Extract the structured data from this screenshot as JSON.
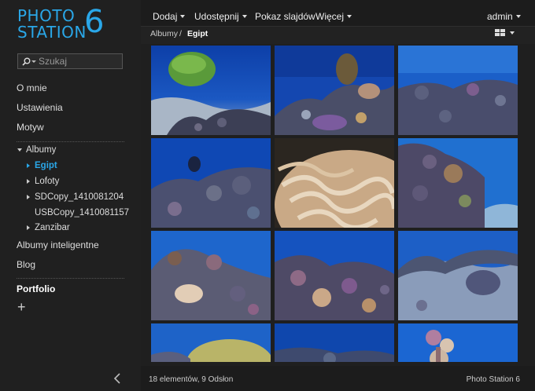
{
  "app": {
    "logo_line1": "PHOTO",
    "logo_line2": "STATION",
    "logo_version": "6",
    "accent_color": "#2aa7e8"
  },
  "search": {
    "placeholder": "Szukaj",
    "icon": "search-icon"
  },
  "sidebar": {
    "items": [
      {
        "label": "O mnie"
      },
      {
        "label": "Ustawienia"
      },
      {
        "label": "Motyw"
      }
    ],
    "albums_label": "Albumy",
    "albums": [
      {
        "label": "Egipt",
        "active": true,
        "expandable": true
      },
      {
        "label": "Lofoty",
        "expandable": true
      },
      {
        "label": "SDCopy_1410081204",
        "expandable": true
      },
      {
        "label": "USBCopy_1410081157",
        "expandable": false
      },
      {
        "label": "Zanzibar",
        "expandable": true
      }
    ],
    "smart_albums_label": "Albumy inteligentne",
    "blog_label": "Blog",
    "portfolio_label": "Portfolio",
    "add_label": "+"
  },
  "toolbar": {
    "add": "Dodaj",
    "share": "Udostępnij",
    "slideshow": "Pokaz slajdów",
    "more": "Więcej",
    "user": "admin"
  },
  "breadcrumb": {
    "root": "Albumy",
    "separator": "/",
    "current": "Egipt"
  },
  "photos": [
    {
      "scene": "coral-ball"
    },
    {
      "scene": "reef-right"
    },
    {
      "scene": "reef-low"
    },
    {
      "scene": "diver-reef"
    },
    {
      "scene": "brain-coral"
    },
    {
      "scene": "reef-pillar"
    },
    {
      "scene": "coral-mound"
    },
    {
      "scene": "reef-colorful"
    },
    {
      "scene": "sand-coral"
    },
    {
      "scene": "table-coral"
    },
    {
      "scene": "deep-blue"
    },
    {
      "scene": "coral-top"
    }
  ],
  "footer": {
    "count": "18 elementów, 9 Odsłon",
    "brand": "Photo Station 6"
  }
}
